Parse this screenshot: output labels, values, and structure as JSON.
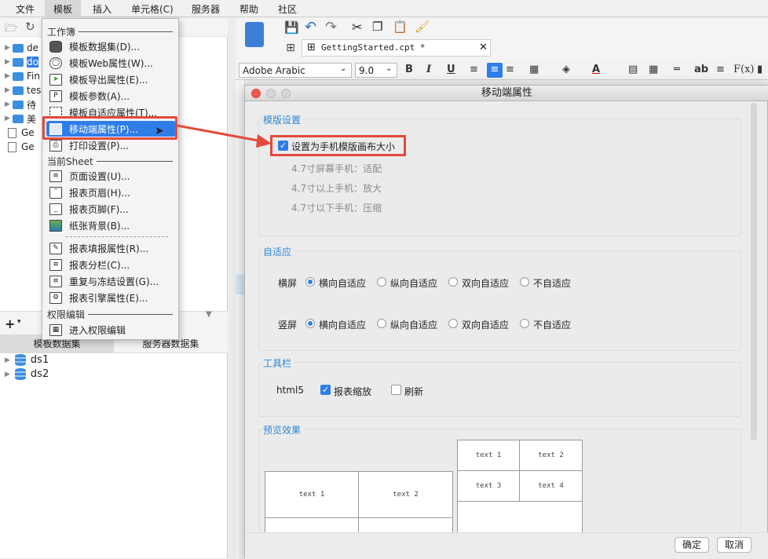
{
  "menubar": {
    "items": [
      "文件",
      "模板",
      "插入",
      "单元格(C)",
      "服务器",
      "帮助",
      "社区"
    ]
  },
  "left_panel": {
    "tree": [
      {
        "name": "de",
        "type": "folder"
      },
      {
        "name": "do",
        "type": "folder"
      },
      {
        "name": "Fin",
        "type": "folder"
      },
      {
        "name": "tes",
        "type": "folder"
      },
      {
        "name": "待",
        "type": "folder"
      },
      {
        "name": "美",
        "type": "folder"
      },
      {
        "name": "Ge",
        "type": "file"
      },
      {
        "name": "Ge",
        "type": "file"
      }
    ],
    "tabs": [
      "模板数据集",
      "服务器数据集"
    ],
    "datasets": [
      "ds1",
      "ds2"
    ]
  },
  "template_menu": {
    "section_workbook": "工作簿",
    "section_sheet": "当前Sheet",
    "section_permission": "权限编辑",
    "items": [
      {
        "label": "模板数据集(D)...",
        "icon": "database-icon"
      },
      {
        "label": "模板Web属性(W)...",
        "icon": "globe-icon"
      },
      {
        "label": "模板导出属性(E)...",
        "icon": "export-icon"
      },
      {
        "label": "模板参数(A)...",
        "icon": "parameter-icon"
      },
      {
        "label": "模板自适应属性(T)...",
        "icon": "adaptive-icon"
      },
      {
        "label": "移动端属性(P)...",
        "icon": "mobile-icon"
      },
      {
        "label": "打印设置(P)...",
        "icon": "printer-icon"
      },
      {
        "label": "页面设置(U)...",
        "icon": "page-setup-icon"
      },
      {
        "label": "报表页眉(H)...",
        "icon": "header-icon"
      },
      {
        "label": "报表页脚(F)...",
        "icon": "footer-icon"
      },
      {
        "label": "纸张背景(B)...",
        "icon": "background-icon"
      },
      {
        "label": "报表填报属性(R)...",
        "icon": "fill-form-icon"
      },
      {
        "label": "报表分栏(C)...",
        "icon": "columns-icon"
      },
      {
        "label": "重复与冻结设置(G)...",
        "icon": "freeze-icon"
      },
      {
        "label": "报表引擎属性(E)...",
        "icon": "engine-icon"
      },
      {
        "label": "进入权限编辑",
        "icon": "permission-icon"
      }
    ]
  },
  "editor": {
    "tab_title": "GettingStarted.cpt *",
    "font_name": "Adobe Arabic",
    "font_size": "9.0"
  },
  "dialog": {
    "title": "移动端属性",
    "template_settings": {
      "title": "模版设置",
      "checkbox_label": "设置为手机模版画布大小",
      "checked": true,
      "notes": [
        "4.7寸屏幕手机：适配",
        "4.7寸以上手机：放大",
        "4.7寸以下手机：压缩"
      ]
    },
    "adaptive": {
      "title": "自适应",
      "landscape_label": "横屏",
      "portrait_label": "竖屏",
      "options": [
        "横向自适应",
        "纵向自适应",
        "双向自适应",
        "不自适应"
      ],
      "landscape_selected": 0,
      "portrait_selected": 0
    },
    "toolbar": {
      "title": "工具栏",
      "html5_label": "html5",
      "zoom_label": "报表缩放",
      "zoom_checked": true,
      "refresh_label": "刷新",
      "refresh_checked": false
    },
    "preview": {
      "title": "预览效果",
      "left_cells": [
        "text 1",
        "text 2"
      ],
      "right_cells": [
        "text 1",
        "text 2",
        "text 3",
        "text 4"
      ]
    },
    "ok_label": "确定",
    "cancel_label": "取消"
  },
  "colors": {
    "accent": "#2f7ee8",
    "highlight": "#e24a3b",
    "group_title": "#2f86d6"
  }
}
